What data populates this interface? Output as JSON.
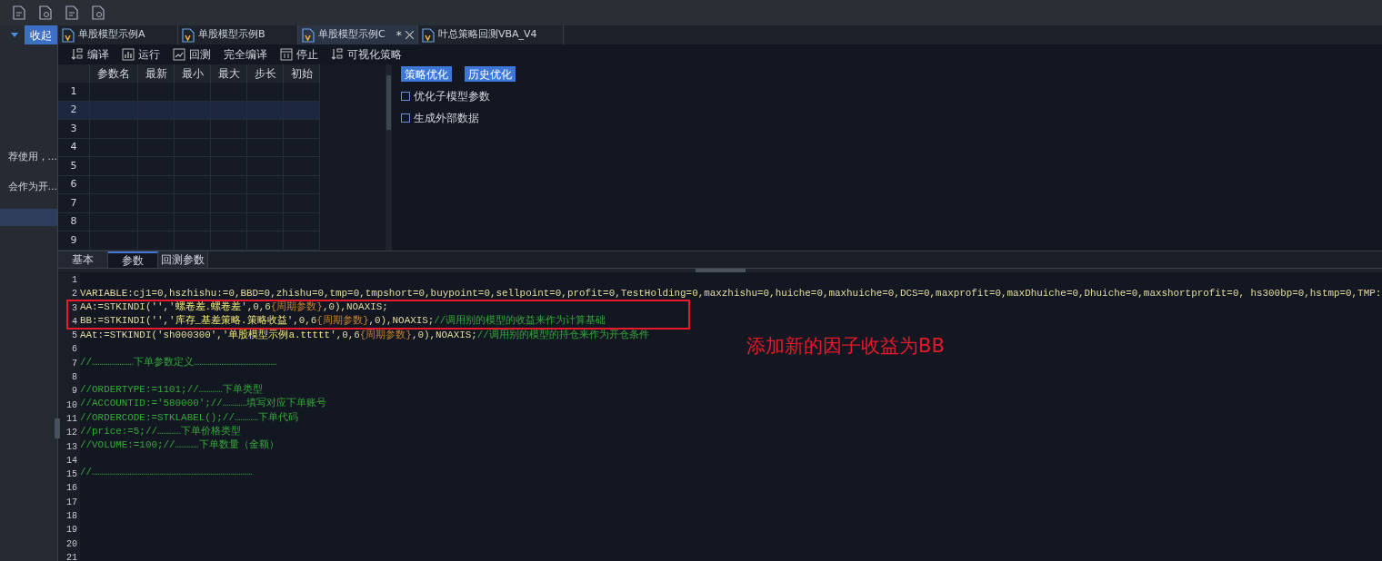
{
  "sidebar": {
    "collapse_button": "收起",
    "items": [
      {
        "label": "荐使用，...",
        "selected": false
      },
      {
        "label": "会作为开...",
        "selected": false
      },
      {
        "selected": true
      }
    ]
  },
  "file_tabs": [
    {
      "label": "单股模型示例A",
      "selected": false
    },
    {
      "label": "单股模型示例B",
      "selected": false
    },
    {
      "label": "单股模型示例C",
      "selected": true,
      "modified": "*"
    },
    {
      "label": "叶总策略回测VBA_V4",
      "selected": false
    }
  ],
  "toolbar": [
    {
      "label": "编译",
      "kind": "sort"
    },
    {
      "label": "运行",
      "kind": "chart"
    },
    {
      "label": "回测",
      "kind": "line"
    },
    {
      "label": "完全编译",
      "kind": "text"
    },
    {
      "label": "停止",
      "kind": "stop"
    },
    {
      "label": "可视化策略",
      "kind": "sort"
    }
  ],
  "param_table": {
    "columns": [
      "参数名",
      "最新",
      "最小",
      "最大",
      "步长",
      "初始"
    ],
    "rows": [
      {
        "number": "1",
        "selected": false
      },
      {
        "number": "2",
        "selected": true
      },
      {
        "number": "3",
        "selected": false
      },
      {
        "number": "4",
        "selected": false
      },
      {
        "number": "5",
        "selected": false
      },
      {
        "number": "6",
        "selected": false
      },
      {
        "number": "7",
        "selected": false
      },
      {
        "number": "8",
        "selected": false
      },
      {
        "number": "9",
        "selected": false
      }
    ]
  },
  "optimize_buttons": [
    "策略优化",
    "历史优化"
  ],
  "options": [
    {
      "label": "优化子模型参数",
      "checked": false
    },
    {
      "label": "生成外部数据",
      "checked": false
    }
  ],
  "bottom_tabs": [
    {
      "label": "基本",
      "selected": false
    },
    {
      "label": "参数",
      "selected": true
    },
    {
      "label": "回测参数",
      "selected": false
    }
  ],
  "code": [
    {
      "number": "1"
    },
    {
      "number": "2",
      "segments": [
        {
          "kind": "code",
          "text": "VARIABLE:cj1=0,hszhishu:=0,BBD=0,zhishu=0,tmp=0,tmpshort=0,buypoint=0,sellpoint=0,profit=0,TestHolding=0,maxzhishu=0,huiche=0,maxhuiche=0,DCS=0,maxprofit=0,maxDhuiche=0,Dhuiche=0,maxshortprofit=0, hs300bp=0,hstmp=0,TMP:"
        }
      ]
    },
    {
      "number": "3",
      "segments": [
        {
          "kind": "code",
          "text": "AA:=STKINDI('','"
        },
        {
          "kind": "string",
          "text": "螺卷差.螺卷差"
        },
        {
          "kind": "code",
          "text": "',0,6"
        },
        {
          "kind": "param",
          "text": "{周期参数}"
        },
        {
          "kind": "code",
          "text": ",0),NOAXIS;"
        }
      ]
    },
    {
      "number": "4",
      "segments": [
        {
          "kind": "code",
          "text": "BB:=STKINDI('','"
        },
        {
          "kind": "string",
          "text": "库存_基差策略.策略收益"
        },
        {
          "kind": "code",
          "text": "',0,6"
        },
        {
          "kind": "param",
          "text": "{周期参数}"
        },
        {
          "kind": "code",
          "text": ",0),NOAXIS;"
        },
        {
          "kind": "comment",
          "text": "//调用别的模型的收益来作为计算基础"
        }
      ]
    },
    {
      "number": "5",
      "segments": [
        {
          "kind": "code",
          "text": "AAt:=STKINDI('sh000300','"
        },
        {
          "kind": "string",
          "text": "单股模型示例a.ttttt"
        },
        {
          "kind": "code",
          "text": "',0,6"
        },
        {
          "kind": "param",
          "text": "{周期参数}"
        },
        {
          "kind": "code",
          "text": ",0),NOAXIS;"
        },
        {
          "kind": "comment",
          "text": "//调用别的模型的持仓来作为开仓条件"
        }
      ]
    },
    {
      "number": "6"
    },
    {
      "number": "7",
      "segments": [
        {
          "kind": "comment",
          "text": "//…………………下单参数定义……………………………………"
        }
      ]
    },
    {
      "number": "8"
    },
    {
      "number": "9",
      "segments": [
        {
          "kind": "comment",
          "text": "//ORDERTYPE:=1101;//…………下单类型"
        }
      ]
    },
    {
      "number": "10",
      "segments": [
        {
          "kind": "comment",
          "text": "//ACCOUNTID:='580000';//…………填写对应下单账号"
        }
      ]
    },
    {
      "number": "11",
      "segments": [
        {
          "kind": "comment",
          "text": "//ORDERCODE:=STKLABEL();//…………下单代码"
        }
      ]
    },
    {
      "number": "12",
      "segments": [
        {
          "kind": "comment",
          "text": "//price:=5;//…………下单价格类型"
        }
      ]
    },
    {
      "number": "13",
      "segments": [
        {
          "kind": "comment",
          "text": "//VOLUME:=100;//…………下单数量（金额）"
        }
      ]
    },
    {
      "number": "14"
    },
    {
      "number": "15",
      "segments": [
        {
          "kind": "comment",
          "text": "//………………………………………………………………………"
        }
      ]
    },
    {
      "number": "16"
    },
    {
      "number": "17"
    },
    {
      "number": "18"
    },
    {
      "number": "19"
    },
    {
      "number": "20"
    },
    {
      "number": "21"
    }
  ],
  "annotation": {
    "text": "添加新的因子收益为BB"
  }
}
